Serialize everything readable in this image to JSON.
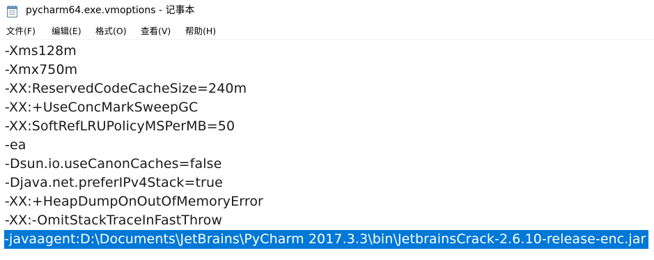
{
  "window": {
    "title": "pycharm64.exe.vmoptions - 记事本",
    "icon": "notepad-icon"
  },
  "menu": [
    {
      "label": "文件(F)"
    },
    {
      "label": "编辑(E)"
    },
    {
      "label": "格式(O)"
    },
    {
      "label": "查看(V)"
    },
    {
      "label": "帮助(H)"
    }
  ],
  "editor": {
    "lines": [
      "-Xms128m",
      "-Xmx750m",
      "-XX:ReservedCodeCacheSize=240m",
      "-XX:+UseConcMarkSweepGC",
      "-XX:SoftRefLRUPolicyMSPerMB=50",
      "-ea",
      "-Dsun.io.useCanonCaches=false",
      "-Djava.net.preferIPv4Stack=true",
      "-XX:+HeapDumpOnOutOfMemoryError",
      "-XX:-OmitStackTraceInFastThrow",
      "-javaagent:D:\\Documents\\JetBrains\\PyCharm 2017.3.3\\bin\\JetbrainsCrack-2.6.10-release-enc.jar"
    ],
    "selected_line_index": 10,
    "selection_color": "#0078d7"
  }
}
